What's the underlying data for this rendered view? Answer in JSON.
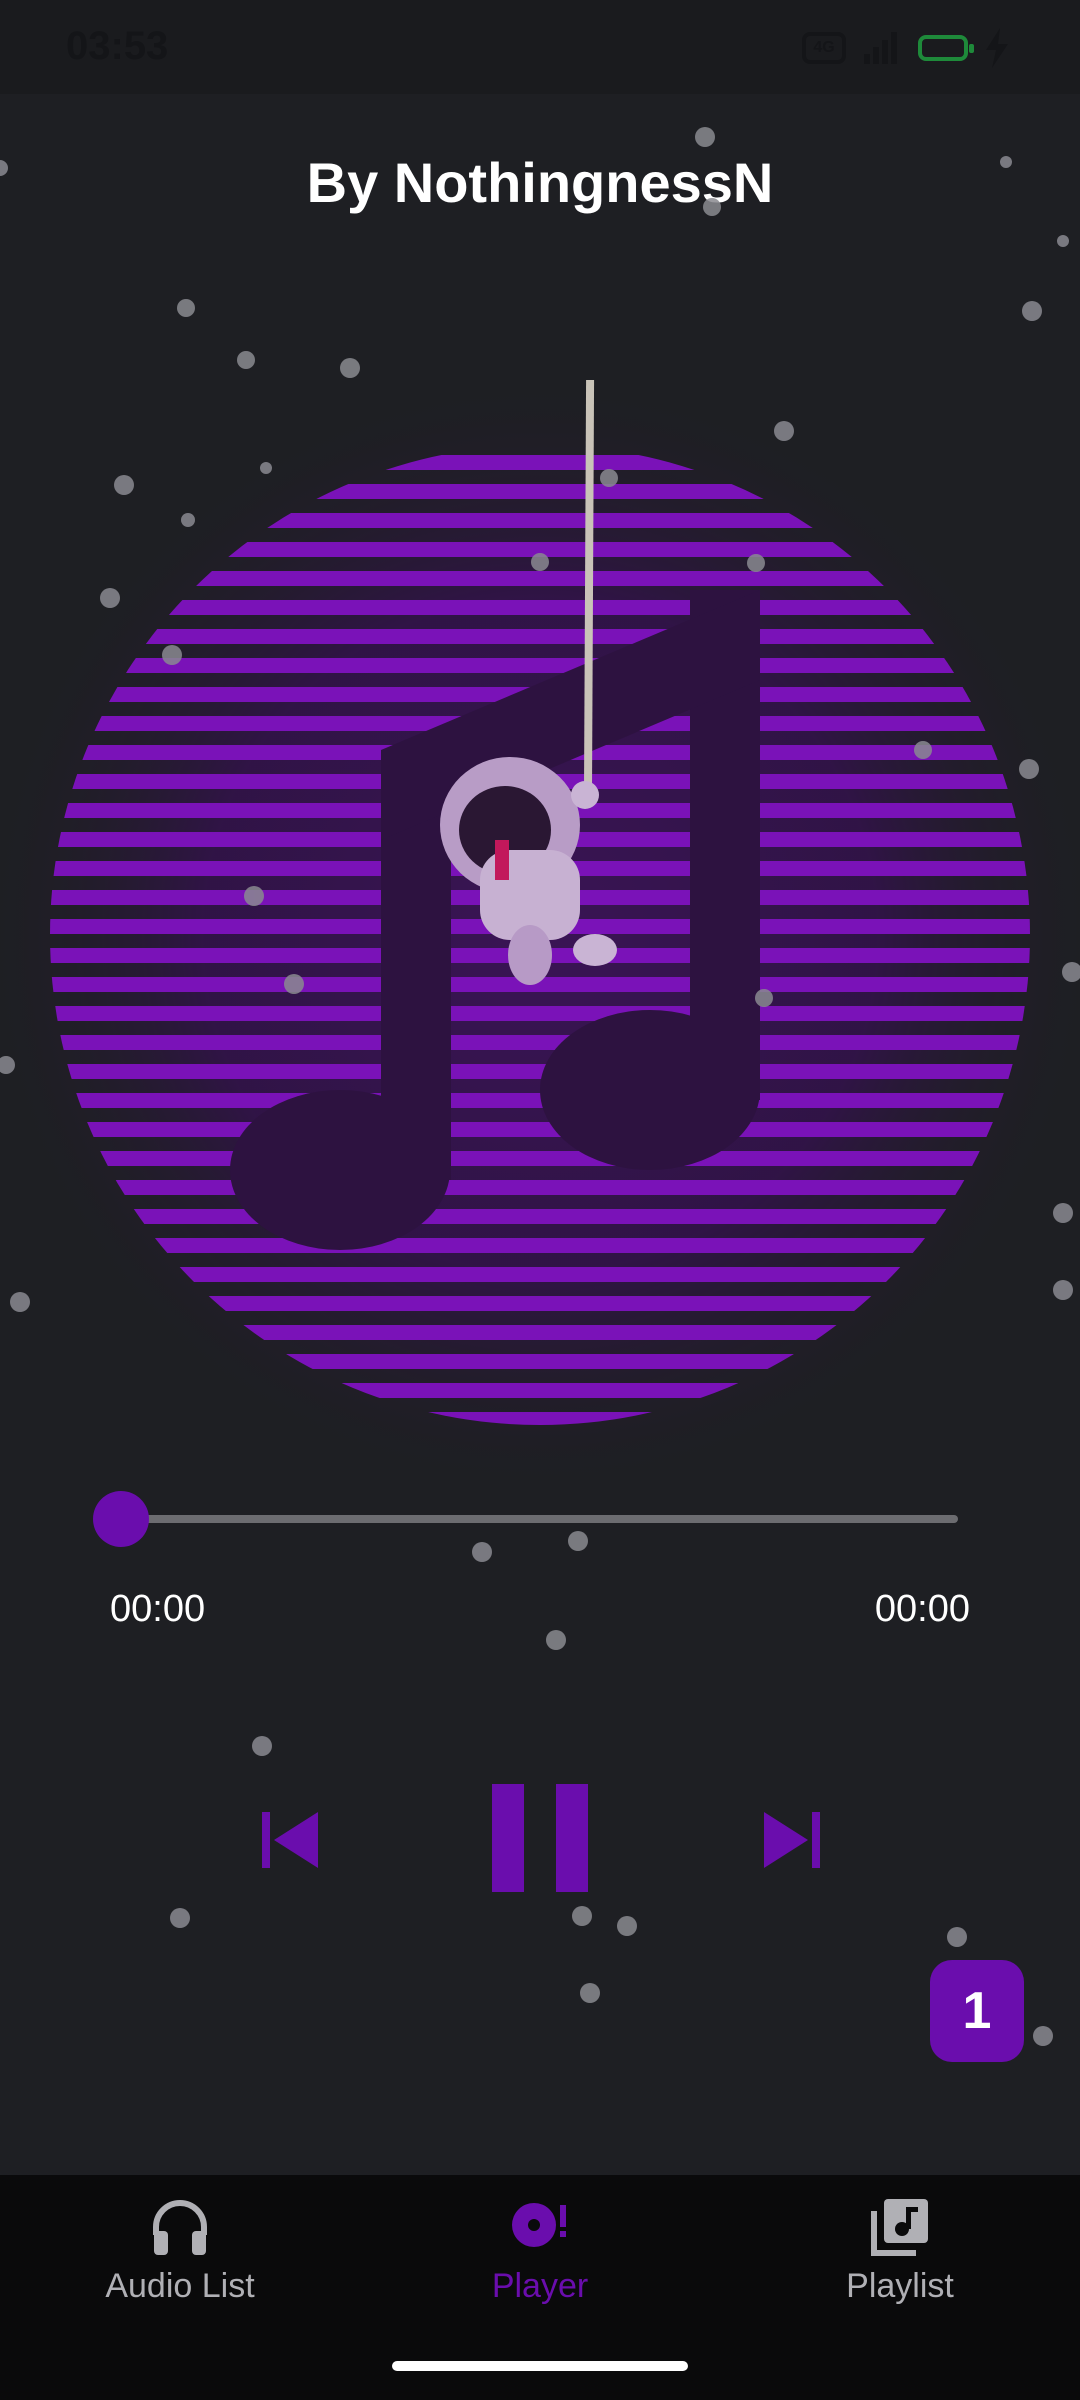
{
  "status_bar": {
    "time": "03:53",
    "network_label": "4G"
  },
  "player": {
    "artist_line": "By NothingnessN",
    "progress_fraction": 0.0,
    "current_time": "00:00",
    "total_time": "00:00",
    "queue_badge": "1",
    "accent_color": "#6a0dad",
    "art_icon": "music-note-astronaut-art",
    "controls": [
      {
        "name": "previous",
        "icon": "skip-previous-icon"
      },
      {
        "name": "pause",
        "icon": "pause-icon"
      },
      {
        "name": "next",
        "icon": "skip-next-icon"
      }
    ]
  },
  "bottom_nav": {
    "items": [
      {
        "label": "Audio List",
        "icon": "headphones-icon",
        "active": false
      },
      {
        "label": "Player",
        "icon": "disc-icon",
        "active": true
      },
      {
        "label": "Playlist",
        "icon": "library-music-icon",
        "active": false
      }
    ]
  }
}
